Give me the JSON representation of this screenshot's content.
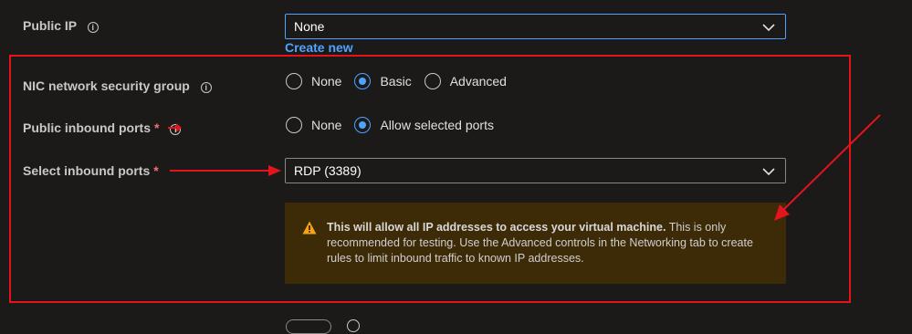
{
  "public_ip": {
    "label": "Public IP",
    "value": "None",
    "create_link": "Create new"
  },
  "nic_nsg": {
    "label": "NIC network security group",
    "options": [
      "None",
      "Basic",
      "Advanced"
    ],
    "selected": "Basic"
  },
  "public_inbound": {
    "label": "Public inbound ports",
    "required_mark": "*",
    "options": [
      "None",
      "Allow selected ports"
    ],
    "selected": "Allow selected ports"
  },
  "select_inbound": {
    "label": "Select inbound ports",
    "required_mark": "*",
    "value": "RDP (3389)"
  },
  "warning": {
    "bold": "This will allow all IP addresses to access your virtual machine.",
    "text": "This is only recommended for testing.  Use the Advanced controls in the Networking tab to create rules to limit inbound traffic to known IP addresses."
  },
  "colors": {
    "accent": "#4da3ff",
    "annotation": "#e3141c",
    "warning_bg": "#3d2a07",
    "warning_icon": "#f7a21b"
  }
}
